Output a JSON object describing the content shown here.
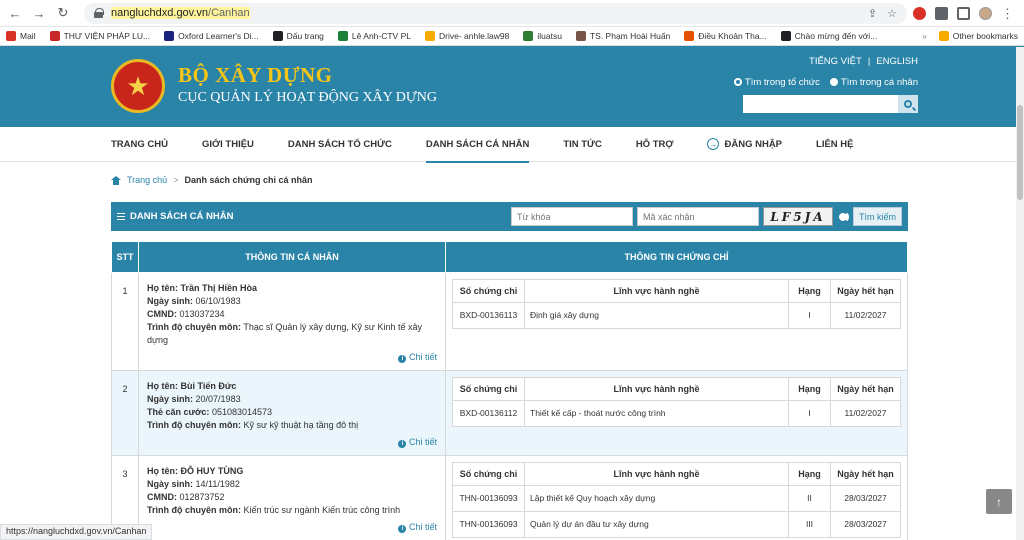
{
  "browser": {
    "url_host": "nangluchdxd.gov.vn",
    "url_path": "/Canhan",
    "status_url": "https://nangluchdxd.gov.vn/Canhan",
    "bookmarks": [
      {
        "label": "Mail",
        "color": "#d93025"
      },
      {
        "label": "THƯ VIỆN PHÁP LU...",
        "color": "#c62828"
      },
      {
        "label": "Oxford Learner's Di...",
        "color": "#1a237e"
      },
      {
        "label": "Dấu trang",
        "color": "#202124"
      },
      {
        "label": "Lê Anh-CTV PL",
        "color": "#188038"
      },
      {
        "label": "Drive- anhle.law98",
        "color": "#f9ab00"
      },
      {
        "label": "iluatsu",
        "color": "#2e7d32"
      },
      {
        "label": "TS. Phạm Hoài Huấn",
        "color": "#795548"
      },
      {
        "label": "Điều Khoản Tha...",
        "color": "#e65100"
      },
      {
        "label": "Chào mừng đến với...",
        "color": "#202124"
      }
    ],
    "bookmarks_more": "»",
    "other_bookmarks": "Other bookmarks"
  },
  "header": {
    "title": "BỘ XÂY DỰNG",
    "subtitle": "CỤC QUẢN LÝ HOẠT ĐỘNG XÂY DỰNG",
    "lang_vi": "TIẾNG VIỆT",
    "lang_sep": "|",
    "lang_en": "ENGLISH",
    "scope_org": "Tìm trong tổ chức",
    "scope_person": "Tìm trong cá nhân"
  },
  "nav": {
    "items": [
      "TRANG CHỦ",
      "GIỚI THIỆU",
      "DANH SÁCH TỔ CHỨC",
      "DANH SÁCH CÁ NHÂN",
      "TIN TỨC",
      "HỖ TRỢ",
      "ĐĂNG NHẬP",
      "LIÊN HỆ"
    ],
    "active_index": 3
  },
  "breadcrumb": {
    "home": "Trang chủ",
    "sep": ">",
    "current": "Danh sách chứng chỉ cá nhân"
  },
  "list": {
    "title": "DANH SÁCH CÁ NHÂN",
    "keyword_placeholder": "Từ khóa",
    "captcha_placeholder": "Mã xác nhận",
    "captcha_text": "LF5JA",
    "search_button": "Tìm kiếm"
  },
  "table": {
    "headers": {
      "stt": "STT",
      "info": "THÔNG TIN CÁ NHÂN",
      "certs": "THÔNG TIN CHỨNG CHỈ"
    },
    "cert_headers": {
      "number": "Số chứng chỉ",
      "field": "Lĩnh vực hành nghề",
      "rank": "Hạng",
      "expiry": "Ngày hết hạn"
    },
    "detail_label": "Chi tiết",
    "rows": [
      {
        "stt": "1",
        "name_label": "Họ tên:",
        "name": "Trần Thị Hiền Hòa",
        "dob_label": "Ngày sinh:",
        "dob": "06/10/1983",
        "id_label": "CMND:",
        "id": "013037234",
        "edu_label": "Trình độ chuyên môn:",
        "edu": "Thạc sĩ Quản lý xây dựng, Kỹ sư Kinh tế xây dựng",
        "certs": [
          {
            "number": "BXD-00136113",
            "field": "Định giá xây dựng",
            "rank": "I",
            "expiry": "11/02/2027"
          }
        ]
      },
      {
        "stt": "2",
        "name_label": "Họ tên:",
        "name": "Bùi Tiến Đức",
        "dob_label": "Ngày sinh:",
        "dob": "20/07/1983",
        "id_label": "Thẻ căn cước:",
        "id": "051083014573",
        "edu_label": "Trình độ chuyên môn:",
        "edu": "Kỹ sư kỹ thuật hạ tầng đô thị",
        "certs": [
          {
            "number": "BXD-00136112",
            "field": "Thiết kế cấp - thoát nước công trình",
            "rank": "I",
            "expiry": "11/02/2027"
          }
        ]
      },
      {
        "stt": "3",
        "name_label": "Họ tên:",
        "name": "ĐỖ HUY TÙNG",
        "dob_label": "Ngày sinh:",
        "dob": "14/11/1982",
        "id_label": "CMND:",
        "id": "012873752",
        "edu_label": "Trình độ chuyên môn:",
        "edu": "Kiến trúc sư ngành Kiến trúc công trình",
        "certs": [
          {
            "number": "THN-00136093",
            "field": "Lập thiết kế Quy hoạch xây dựng",
            "rank": "II",
            "expiry": "28/03/2027"
          },
          {
            "number": "THN-00136093",
            "field": "Quản lý dự án đầu tư xây dựng",
            "rank": "III",
            "expiry": "28/03/2027"
          }
        ]
      }
    ]
  },
  "back_to_top": "↑"
}
